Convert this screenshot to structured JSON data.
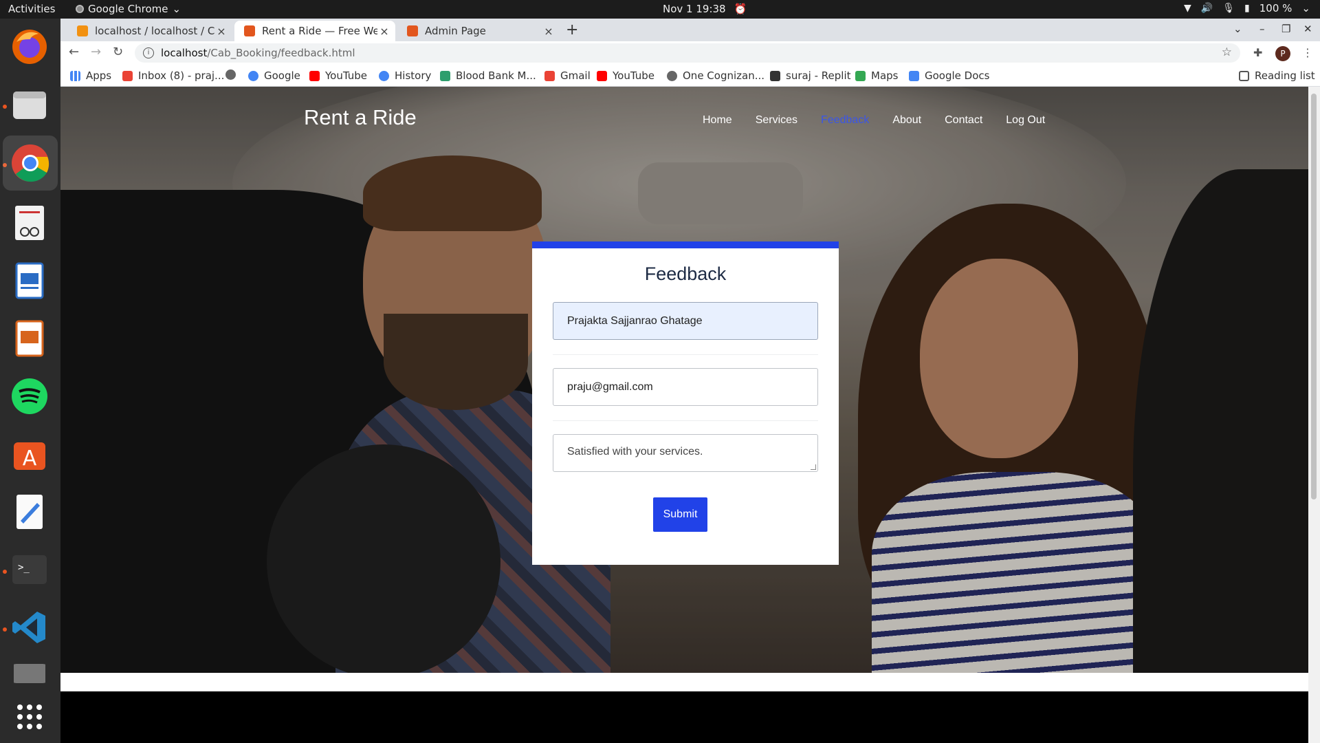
{
  "system": {
    "activities": "Activities",
    "app_name": "Google Chrome",
    "clock": "Nov 1  19:38",
    "battery": "100 %"
  },
  "browser": {
    "tabs": [
      {
        "title": "localhost / localhost / Cab",
        "favicon_color": "#f29111"
      },
      {
        "title": "Rent a Ride — Free Websi",
        "favicon_color": "#e2561e"
      },
      {
        "title": "Admin Page",
        "favicon_color": "#e2561e"
      }
    ],
    "new_tab": "+",
    "url_host": "localhost",
    "url_path": "/Cab_Booking/feedback.html",
    "profile_initial": "P",
    "bookmarks": [
      {
        "label": "Apps",
        "icon": "apps-grid-icon"
      },
      {
        "label": "Inbox (8) - praj...",
        "icon": "gmail-icon"
      },
      {
        "label": "",
        "icon": "globe-icon"
      },
      {
        "label": "Google",
        "icon": "google-icon"
      },
      {
        "label": "YouTube",
        "icon": "youtube-icon"
      },
      {
        "label": "History",
        "icon": "history-icon"
      },
      {
        "label": "Blood Bank M...",
        "icon": "bloodbank-icon"
      },
      {
        "label": "Gmail",
        "icon": "gmail-icon"
      },
      {
        "label": "YouTube",
        "icon": "youtube-icon"
      },
      {
        "label": "One Cognizan...",
        "icon": "globe-icon"
      },
      {
        "label": "suraj - Replit",
        "icon": "replit-icon"
      },
      {
        "label": "Maps",
        "icon": "maps-icon"
      },
      {
        "label": "Google Docs",
        "icon": "docs-icon"
      }
    ],
    "reading_list": "Reading list"
  },
  "site": {
    "logo": "Rent a Ride",
    "nav": [
      {
        "label": "Home",
        "active": false
      },
      {
        "label": "Services",
        "active": false
      },
      {
        "label": "Feedback",
        "active": true
      },
      {
        "label": "About",
        "active": false
      },
      {
        "label": "Contact",
        "active": false
      },
      {
        "label": "Log Out",
        "active": false
      }
    ],
    "accent_color": "#2142e8"
  },
  "feedback_form": {
    "title": "Feedback",
    "name_value": "Prajakta Sajjanrao Ghatage",
    "email_value": "praju@gmail.com",
    "message_value": "Satisfied with your services.",
    "submit_label": "Submit"
  }
}
